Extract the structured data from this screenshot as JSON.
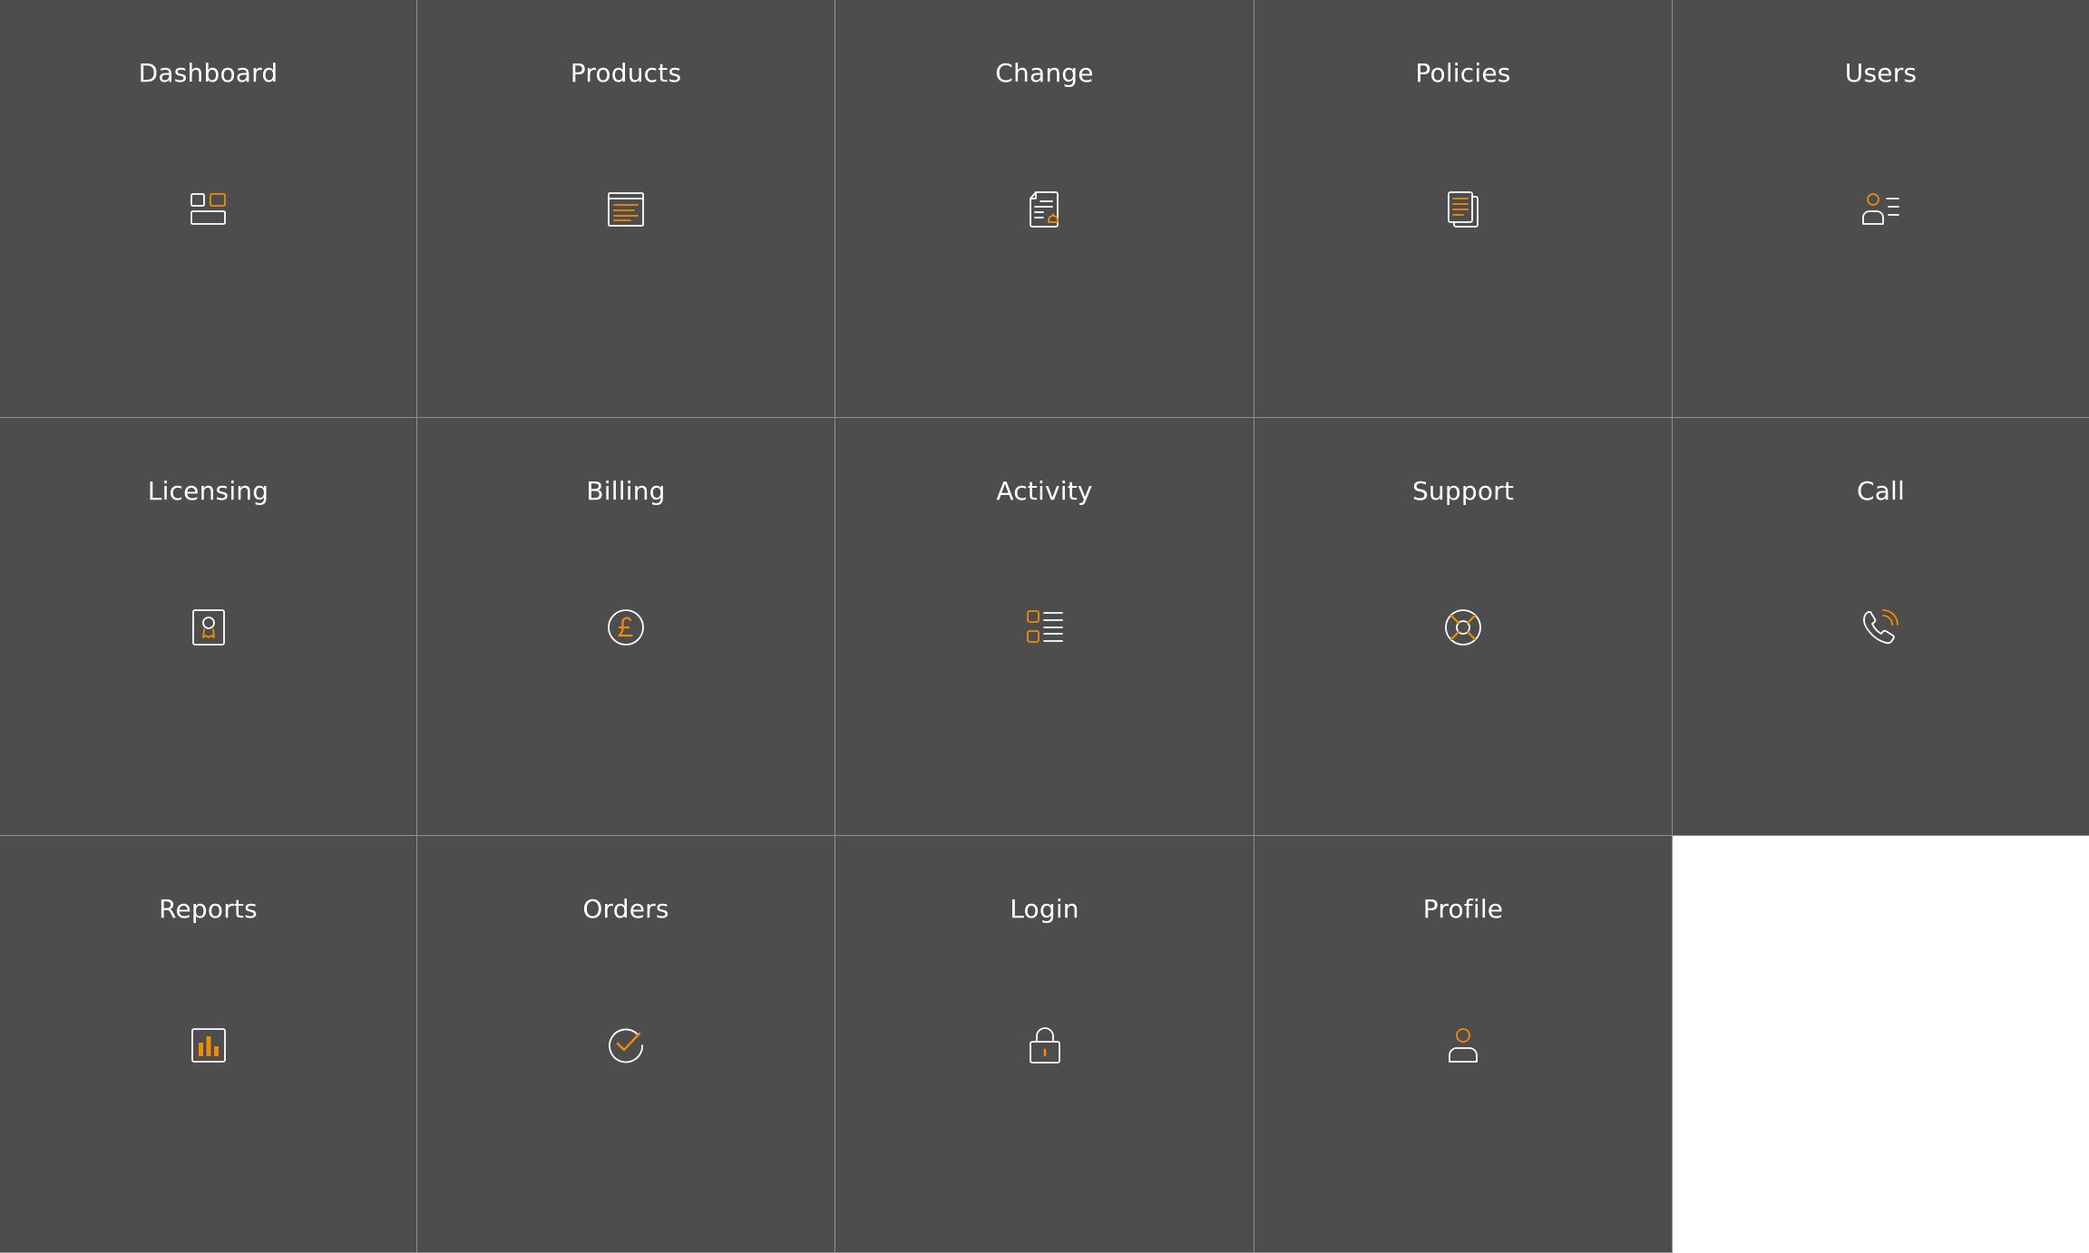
{
  "colors": {
    "tile_background": "#4d4d4d",
    "grid_line": "#8f8f8f",
    "label_text": "#ffffff",
    "icon_stroke": "#ffffff",
    "icon_accent": "#f08c00",
    "empty_background": "#ffffff"
  },
  "tiles": [
    {
      "label": "Dashboard",
      "icon": "dashboard-icon"
    },
    {
      "label": "Products",
      "icon": "products-icon"
    },
    {
      "label": "Change",
      "icon": "change-icon"
    },
    {
      "label": "Policies",
      "icon": "policies-icon"
    },
    {
      "label": "Users",
      "icon": "users-icon"
    },
    {
      "label": "Licensing",
      "icon": "licensing-icon"
    },
    {
      "label": "Billing",
      "icon": "billing-icon"
    },
    {
      "label": "Activity",
      "icon": "activity-icon"
    },
    {
      "label": "Support",
      "icon": "support-icon"
    },
    {
      "label": "Call",
      "icon": "call-icon"
    },
    {
      "label": "Reports",
      "icon": "reports-icon"
    },
    {
      "label": "Orders",
      "icon": "orders-icon"
    },
    {
      "label": "Login",
      "icon": "login-icon"
    },
    {
      "label": "Profile",
      "icon": "profile-icon"
    }
  ]
}
